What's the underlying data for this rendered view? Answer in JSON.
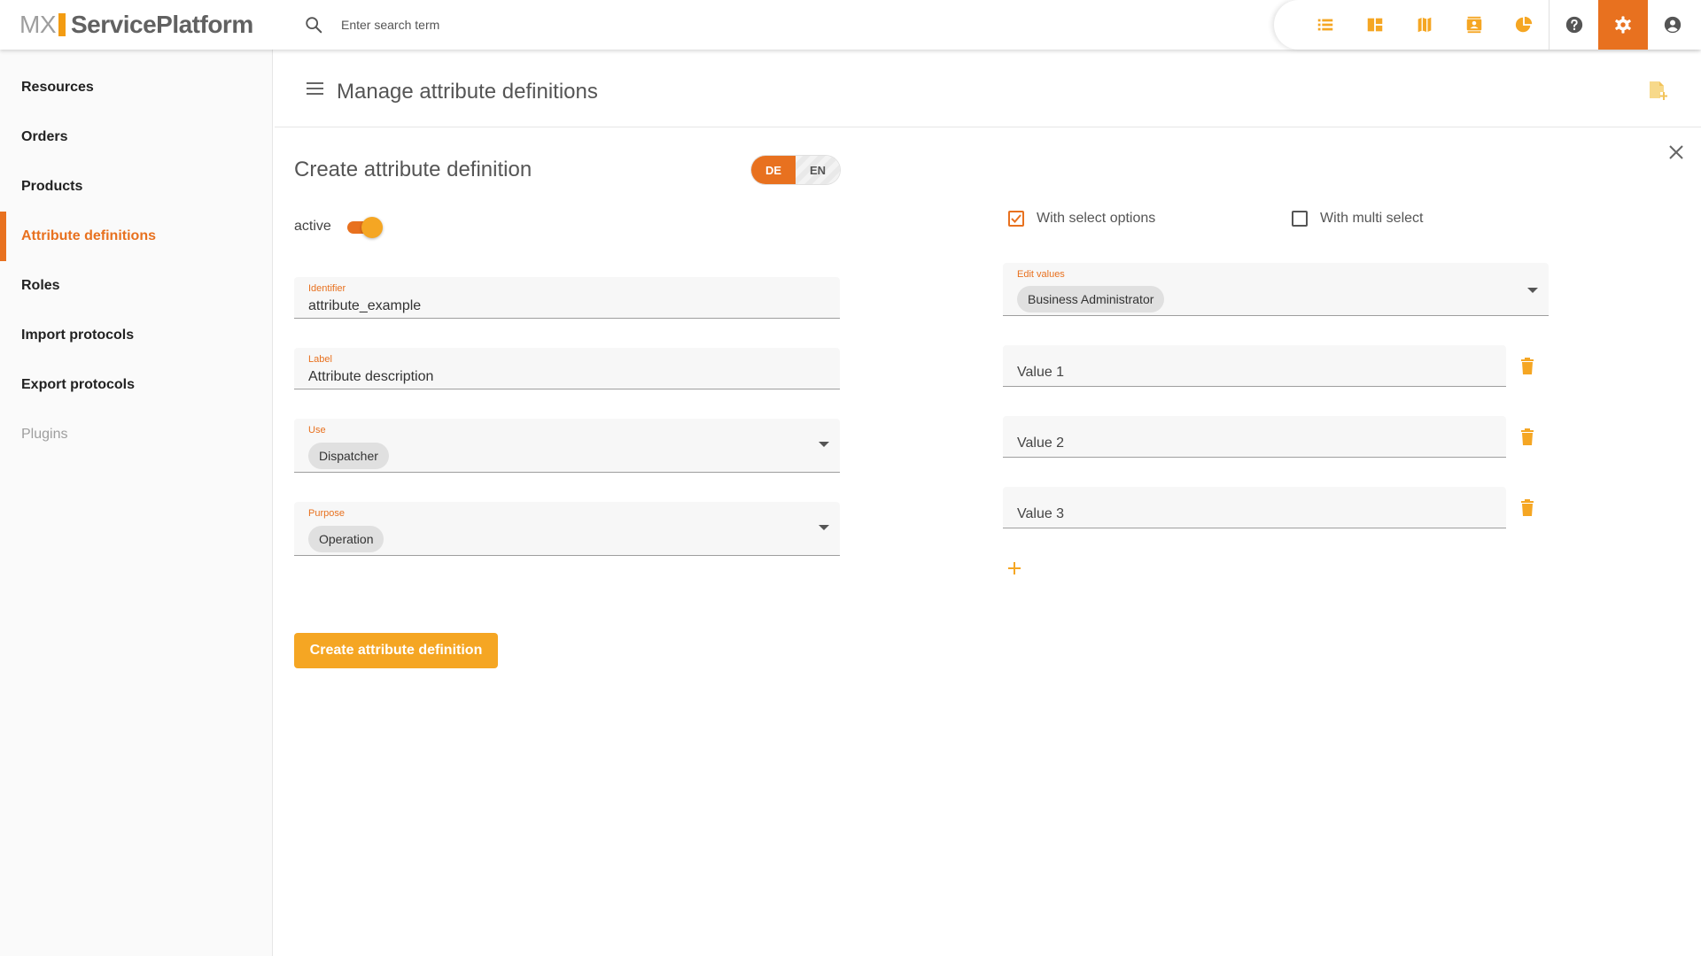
{
  "app": {
    "logo_mx": "MX",
    "logo_name": "ServicePlatform",
    "search_placeholder": "Enter search term"
  },
  "top_nav": {
    "icons": [
      "list-icon",
      "dashboard-icon",
      "map-icon",
      "contacts-icon",
      "pie-chart-icon",
      "help-icon",
      "settings-icon",
      "account-icon"
    ],
    "active": "settings-icon",
    "accent_color": "#e8711f",
    "icon_color": "#f5a623"
  },
  "sidebar": {
    "items": [
      {
        "label": "Resources"
      },
      {
        "label": "Orders"
      },
      {
        "label": "Products"
      },
      {
        "label": "Attribute definitions"
      },
      {
        "label": "Roles"
      },
      {
        "label": "Import protocols"
      },
      {
        "label": "Export protocols"
      },
      {
        "label": "Plugins"
      }
    ],
    "active_item": "Attribute definitions",
    "disabled_item": "Plugins"
  },
  "header": {
    "title": "Manage attribute definitions"
  },
  "form": {
    "title": "Create attribute definition",
    "languages": [
      "DE",
      "EN"
    ],
    "selected_language": "DE",
    "active_label": "active",
    "active_on": true,
    "identifier": {
      "label": "Identifier",
      "value": "attribute_example"
    },
    "label_field": {
      "label": "Label",
      "value": "Attribute description"
    },
    "use": {
      "label": "Use",
      "value": "Dispatcher"
    },
    "purpose": {
      "label": "Purpose",
      "value": "Operation"
    },
    "submit_label": "Create attribute definition",
    "with_select_options": {
      "label": "With select options",
      "checked": true
    },
    "with_multi_select": {
      "label": "With multi select",
      "checked": false
    },
    "edit_values": {
      "label": "Edit values",
      "value": "Business Administrator"
    },
    "values": [
      {
        "value": "Value 1"
      },
      {
        "value": "Value 2"
      },
      {
        "value": "Value 3"
      }
    ]
  }
}
